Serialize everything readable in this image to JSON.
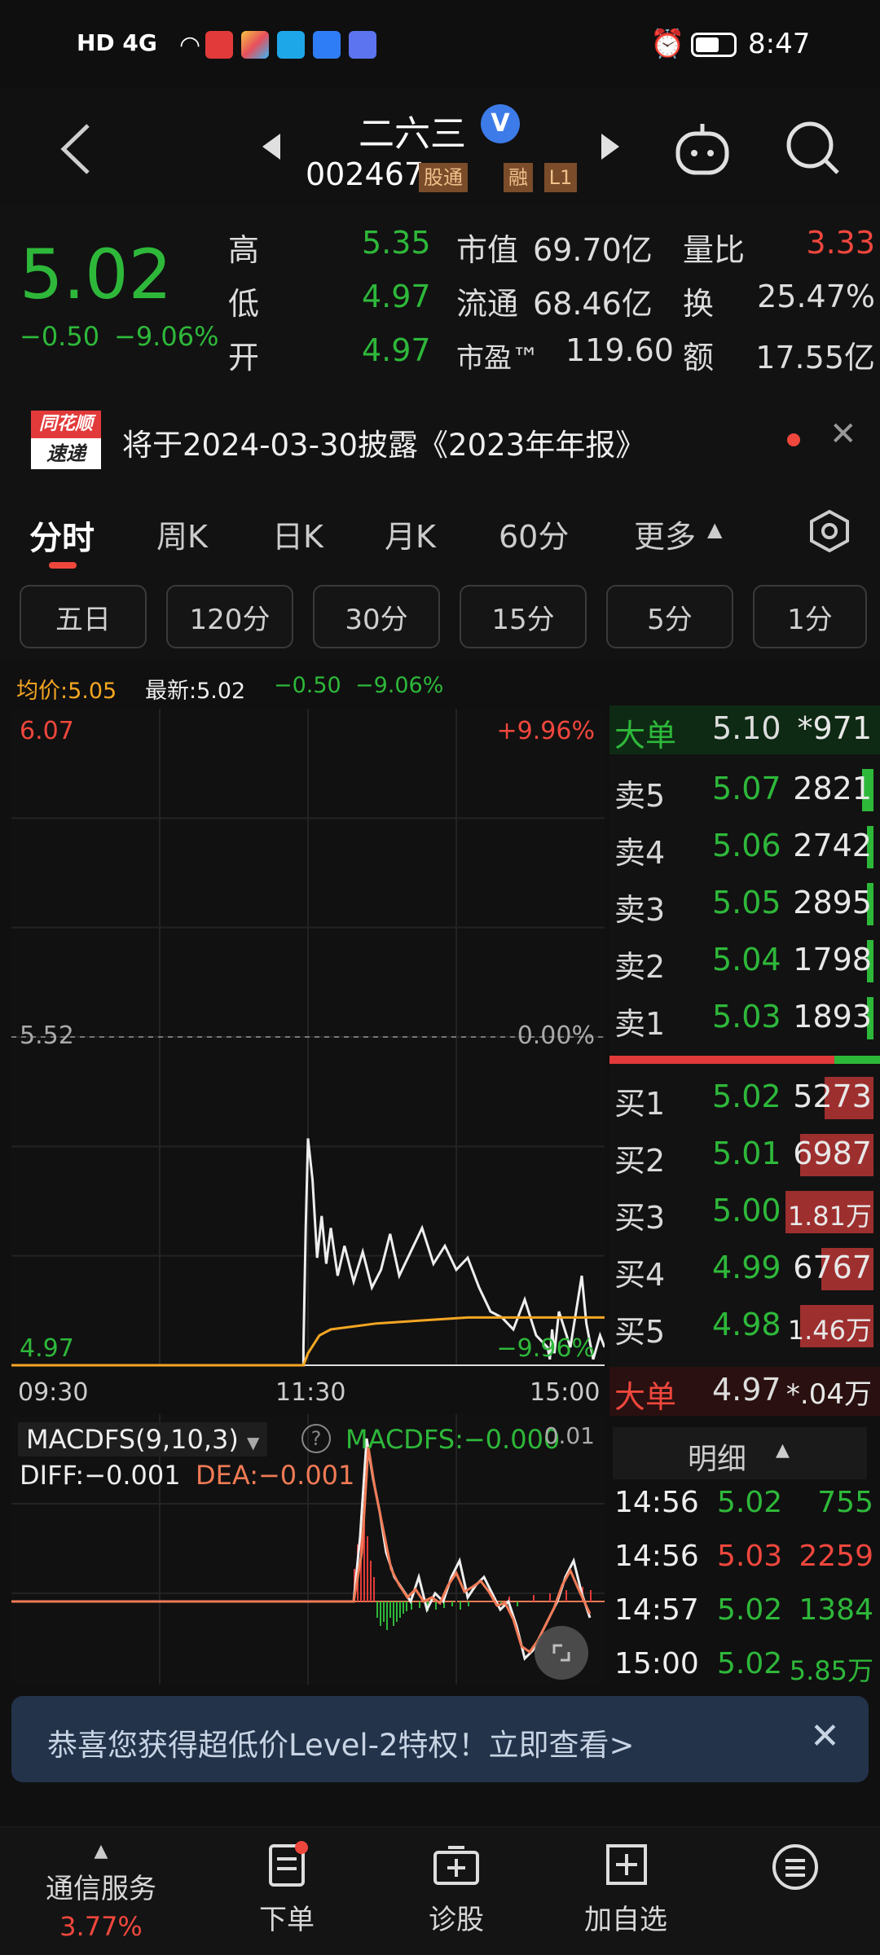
{
  "status": {
    "time": "8:47",
    "signal": "HD 4G"
  },
  "nav": {
    "stock_name": "二六三",
    "code": "002467",
    "tag_connect": "股通",
    "tag_margin": "融",
    "tag_level": "L1"
  },
  "quote": {
    "price": "5.02",
    "change": "−0.50",
    "change_pct": "−9.06%",
    "rows": [
      {
        "l1": "高",
        "v1": "5.35",
        "l2": "市值",
        "v2": "69.70亿",
        "l3": "量比",
        "v3": "3.33"
      },
      {
        "l1": "低",
        "v1": "4.97",
        "l2": "流通",
        "v2": "68.46亿",
        "l3": "换",
        "v3": "25.47%"
      },
      {
        "l1": "开",
        "v1": "4.97",
        "l2": "市盈™",
        "v2": "119.60",
        "l3": "额",
        "v3": "17.55亿"
      }
    ]
  },
  "notice": {
    "logo_top": "同花顺",
    "logo_bottom": "速递",
    "text": "将于2024-03-30披露《2023年年报》"
  },
  "tabs": {
    "items": [
      "分时",
      "周K",
      "日K",
      "月K",
      "60分",
      "更多"
    ],
    "active": "分时"
  },
  "subtabs": [
    "五日",
    "120分",
    "30分",
    "15分",
    "5分",
    "1分"
  ],
  "infoline": {
    "avg": "均价:5.05",
    "latest": "最新:5.02",
    "chg": "−0.50",
    "pct": "−9.06%"
  },
  "chart_data": {
    "type": "line",
    "title": "",
    "x_ticks": [
      "09:30",
      "11:30",
      "15:00"
    ],
    "y_top": "6.07",
    "y_mid": "5.52",
    "y_bottom": "4.97",
    "pct_top": "+9.96%",
    "pct_mid": "0.00%",
    "pct_bottom": "−9.96%",
    "ylim": [
      4.97,
      6.07
    ],
    "series": [
      {
        "x": [
          0,
          128,
          128,
          129,
          130,
          132,
          134,
          136,
          138,
          140,
          143,
          146,
          150,
          154,
          158,
          162,
          166,
          170,
          175,
          180,
          185,
          190,
          195,
          200,
          205,
          210,
          215,
          220,
          225,
          230,
          235,
          236,
          237,
          238,
          240,
          245,
          250,
          252,
          255,
          258,
          260
        ],
        "y": [
          4.97,
          4.97,
          5.0,
          5.2,
          5.35,
          5.28,
          5.15,
          5.22,
          5.14,
          5.2,
          5.12,
          5.17,
          5.11,
          5.16,
          5.1,
          5.13,
          5.19,
          5.12,
          5.16,
          5.2,
          5.14,
          5.17,
          5.13,
          5.15,
          5.1,
          5.06,
          5.05,
          5.03,
          5.08,
          5.02,
          5.0,
          4.98,
          5.03,
          4.99,
          5.06,
          5.0,
          5.12,
          5.04,
          4.98,
          5.02,
          5.0
        ]
      },
      {
        "x": [
          0,
          128,
          130,
          135,
          140,
          150,
          160,
          180,
          200,
          220,
          240,
          260
        ],
        "y": [
          4.97,
          4.97,
          4.99,
          5.02,
          5.03,
          5.035,
          5.04,
          5.045,
          5.05,
          5.05,
          5.05,
          5.05
        ]
      }
    ]
  },
  "macd": {
    "name": "MACDFS(9,10,3)",
    "value": "MACDFS:−0.000",
    "diff": "DIFF:−0.001",
    "dea": "DEA:−0.001",
    "top": "0.01"
  },
  "orderbook": {
    "big_top": {
      "label": "大单",
      "price": "5.10",
      "vol": "*971"
    },
    "sells": [
      {
        "label": "卖5",
        "price": "5.07",
        "vol": "2821"
      },
      {
        "label": "卖4",
        "price": "5.06",
        "vol": "2742"
      },
      {
        "label": "卖3",
        "price": "5.05",
        "vol": "2895"
      },
      {
        "label": "卖2",
        "price": "5.04",
        "vol": "1798"
      },
      {
        "label": "卖1",
        "price": "5.03",
        "vol": "1893"
      }
    ],
    "buys": [
      {
        "label": "买1",
        "price": "5.02",
        "vol": "5273"
      },
      {
        "label": "买2",
        "price": "5.01",
        "vol": "6987"
      },
      {
        "label": "买3",
        "price": "5.00",
        "vol": "1.81万"
      },
      {
        "label": "买4",
        "price": "4.99",
        "vol": "6767"
      },
      {
        "label": "买5",
        "price": "4.98",
        "vol": "1.46万"
      }
    ],
    "big_bottom": {
      "label": "大单",
      "price": "4.97",
      "vol": "*.04万"
    }
  },
  "ticks": {
    "header": "明细",
    "rows": [
      {
        "t": "14:56",
        "p": "5.02",
        "v": "755",
        "dir": "down"
      },
      {
        "t": "14:56",
        "p": "5.03",
        "v": "2259",
        "dir": "up"
      },
      {
        "t": "14:57",
        "p": "5.02",
        "v": "1384",
        "dir": "down"
      },
      {
        "t": "15:00",
        "p": "5.02",
        "v": "5.85万",
        "dir": "down"
      }
    ]
  },
  "promo": {
    "text": "恭喜您获得超低价Level-2特权！立即查看>"
  },
  "bottomnav": [
    {
      "label": "通信服务",
      "sub": "3.77%"
    },
    {
      "label": "下单"
    },
    {
      "label": "诊股"
    },
    {
      "label": "加自选"
    },
    {
      "label": ""
    }
  ],
  "colors": {
    "up": "#f0473d",
    "down": "#2eb83a",
    "avg": "#f5a623"
  }
}
